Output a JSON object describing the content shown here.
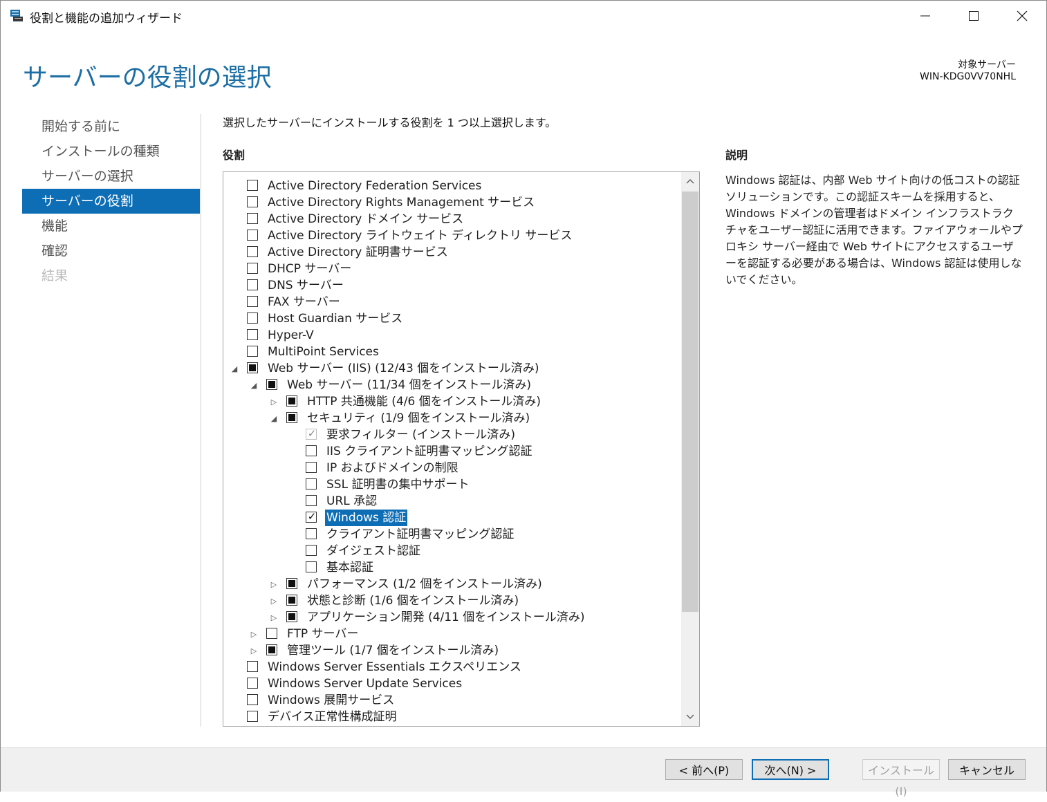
{
  "window": {
    "title": "役割と機能の追加ウィザード"
  },
  "page": {
    "title": "サーバーの役割の選択",
    "target_label": "対象サーバー",
    "target_name": "WIN-KDG0VV70NHL"
  },
  "nav": {
    "items": [
      {
        "label": "開始する前に",
        "state": "normal"
      },
      {
        "label": "インストールの種類",
        "state": "normal"
      },
      {
        "label": "サーバーの選択",
        "state": "normal"
      },
      {
        "label": "サーバーの役割",
        "state": "active"
      },
      {
        "label": "機能",
        "state": "normal"
      },
      {
        "label": "確認",
        "state": "normal"
      },
      {
        "label": "結果",
        "state": "disabled"
      }
    ]
  },
  "main": {
    "instruction": "選択したサーバーにインストールする役割を 1 つ以上選択します。",
    "roles_heading": "役割",
    "roles": [
      {
        "label": "Active Directory Federation Services",
        "level": 0,
        "expander": "none",
        "check": "unchecked"
      },
      {
        "label": "Active Directory Rights Management サービス",
        "level": 0,
        "expander": "none",
        "check": "unchecked"
      },
      {
        "label": "Active Directory ドメイン サービス",
        "level": 0,
        "expander": "none",
        "check": "unchecked"
      },
      {
        "label": "Active Directory ライトウェイト ディレクトリ サービス",
        "level": 0,
        "expander": "none",
        "check": "unchecked"
      },
      {
        "label": "Active Directory 証明書サービス",
        "level": 0,
        "expander": "none",
        "check": "unchecked"
      },
      {
        "label": "DHCP サーバー",
        "level": 0,
        "expander": "none",
        "check": "unchecked"
      },
      {
        "label": "DNS サーバー",
        "level": 0,
        "expander": "none",
        "check": "unchecked"
      },
      {
        "label": "FAX サーバー",
        "level": 0,
        "expander": "none",
        "check": "unchecked"
      },
      {
        "label": "Host Guardian サービス",
        "level": 0,
        "expander": "none",
        "check": "unchecked"
      },
      {
        "label": "Hyper-V",
        "level": 0,
        "expander": "none",
        "check": "unchecked"
      },
      {
        "label": "MultiPoint Services",
        "level": 0,
        "expander": "none",
        "check": "unchecked"
      },
      {
        "label": "Web サーバー (IIS) (12/43 個をインストール済み)",
        "level": 0,
        "expander": "expanded",
        "check": "partial"
      },
      {
        "label": "Web サーバー (11/34 個をインストール済み)",
        "level": 1,
        "expander": "expanded",
        "check": "partial"
      },
      {
        "label": "HTTP 共通機能 (4/6 個をインストール済み)",
        "level": 2,
        "expander": "collapsed",
        "check": "partial"
      },
      {
        "label": "セキュリティ (1/9 個をインストール済み)",
        "level": 2,
        "expander": "expanded",
        "check": "partial"
      },
      {
        "label": "要求フィルター (インストール済み)",
        "level": 3,
        "expander": "none",
        "check": "checked-disabled"
      },
      {
        "label": "IIS クライアント証明書マッピング認証",
        "level": 3,
        "expander": "none",
        "check": "unchecked"
      },
      {
        "label": "IP およびドメインの制限",
        "level": 3,
        "expander": "none",
        "check": "unchecked"
      },
      {
        "label": "SSL 証明書の集中サポート",
        "level": 3,
        "expander": "none",
        "check": "unchecked"
      },
      {
        "label": "URL 承認",
        "level": 3,
        "expander": "none",
        "check": "unchecked"
      },
      {
        "label": "Windows 認証",
        "level": 3,
        "expander": "none",
        "check": "checked",
        "selected": true
      },
      {
        "label": "クライアント証明書マッピング認証",
        "level": 3,
        "expander": "none",
        "check": "unchecked"
      },
      {
        "label": "ダイジェスト認証",
        "level": 3,
        "expander": "none",
        "check": "unchecked"
      },
      {
        "label": "基本認証",
        "level": 3,
        "expander": "none",
        "check": "unchecked"
      },
      {
        "label": "パフォーマンス (1/2 個をインストール済み)",
        "level": 2,
        "expander": "collapsed",
        "check": "partial"
      },
      {
        "label": "状態と診断 (1/6 個をインストール済み)",
        "level": 2,
        "expander": "collapsed",
        "check": "partial"
      },
      {
        "label": "アプリケーション開発 (4/11 個をインストール済み)",
        "level": 2,
        "expander": "collapsed",
        "check": "partial"
      },
      {
        "label": "FTP サーバー",
        "level": 1,
        "expander": "collapsed",
        "check": "unchecked"
      },
      {
        "label": "管理ツール (1/7 個をインストール済み)",
        "level": 1,
        "expander": "collapsed",
        "check": "partial"
      },
      {
        "label": "Windows Server Essentials エクスペリエンス",
        "level": 0,
        "expander": "none",
        "check": "unchecked"
      },
      {
        "label": "Windows Server Update Services",
        "level": 0,
        "expander": "none",
        "check": "unchecked"
      },
      {
        "label": "Windows 展開サービス",
        "level": 0,
        "expander": "none",
        "check": "unchecked"
      },
      {
        "label": "デバイス正常性構成証明",
        "level": 0,
        "expander": "none",
        "check": "unchecked"
      }
    ]
  },
  "description": {
    "heading": "説明",
    "text": "Windows 認証は、内部 Web サイト向けの低コストの認証ソリューションです。この認証スキームを採用すると、Windows ドメインの管理者はドメイン インフラストラクチャをユーザー認証に活用できます。ファイアウォールやプロキシ サーバー経由で Web サイトにアクセスするユーザーを認証する必要がある場合は、Windows 認証は使用しないでください。"
  },
  "footer": {
    "prev_label": "< 前へ(P)",
    "next_label": "次へ(N) >",
    "install_label": "インストール(I)",
    "cancel_label": "キャンセル"
  },
  "colors": {
    "accent": "#0e6eb5",
    "title_blue": "#1c6ea4",
    "footer_bg": "#f0f0f0"
  },
  "icons": {
    "app": "server-manager-icon",
    "minimize": "minimize-icon",
    "maximize": "maximize-icon",
    "close": "close-icon",
    "expanded": "triangle-down-icon",
    "collapsed": "triangle-right-icon",
    "scroll_up": "chevron-up-icon",
    "scroll_down": "chevron-down-icon"
  }
}
